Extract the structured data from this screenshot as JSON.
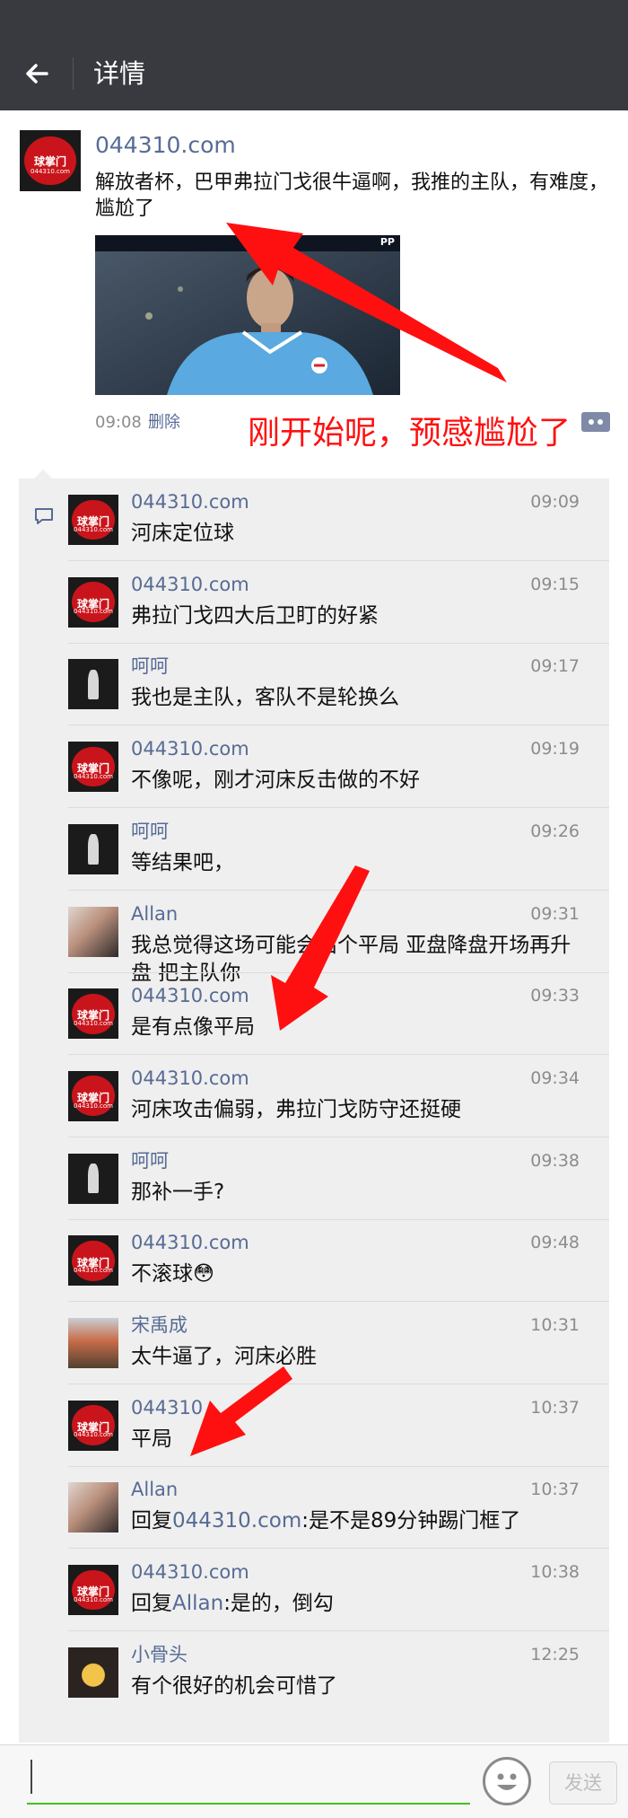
{
  "header": {
    "back_icon": "arrow-left-icon",
    "title": "详情"
  },
  "post": {
    "author": "044310.com",
    "text": "解放者杯，巴甲弗拉门戈很牛逼啊，我推的主队，有难度，尴尬了",
    "media": {
      "caption": "PP"
    },
    "time": "09:08",
    "delete_label": "删除",
    "overlay_annotation": "刚开始呢，预感尴尬了"
  },
  "comments": [
    {
      "name": "044310.com",
      "time": "09:09",
      "text": "河床定位球",
      "avatar": "logo"
    },
    {
      "name": "044310.com",
      "time": "09:15",
      "text": "弗拉门戈四大后卫盯的好紧",
      "avatar": "logo"
    },
    {
      "name": "呵呵",
      "time": "09:17",
      "text": "我也是主队，客队不是轮换么",
      "avatar": "dark"
    },
    {
      "name": "044310.com",
      "time": "09:19",
      "text": "不像呢，刚才河床反击做的不好",
      "avatar": "logo"
    },
    {
      "name": "呵呵",
      "time": "09:26",
      "text": "等结果吧，",
      "avatar": "dark"
    },
    {
      "name": "Allan",
      "time": "09:31",
      "text": "我总觉得这场可能会出个平局 亚盘降盘开场再升盘 把主队你",
      "avatar": "photo1"
    },
    {
      "name": "044310.com",
      "time": "09:33",
      "text": "是有点像平局",
      "avatar": "logo"
    },
    {
      "name": "044310.com",
      "time": "09:34",
      "text": "河床攻击偏弱，弗拉门戈防守还挺硬",
      "avatar": "logo"
    },
    {
      "name": "呵呵",
      "time": "09:38",
      "text": "那补一手?",
      "avatar": "dark"
    },
    {
      "name": "044310.com",
      "time": "09:48",
      "text": "不滚球😳",
      "avatar": "logo"
    },
    {
      "name": "宋禹成",
      "time": "10:31",
      "text": "太牛逼了，河床必胜",
      "avatar": "photo2"
    },
    {
      "name": "044310",
      "time": "10:37",
      "text": "平局",
      "avatar": "logo"
    },
    {
      "name": "Allan",
      "time": "10:37",
      "reply_prefix": "回复",
      "reply_to": "044310.com",
      "reply_text": ":是不是89分钟踢门框了",
      "avatar": "photo1"
    },
    {
      "name": "044310.com",
      "time": "10:38",
      "reply_prefix": "回复",
      "reply_to": "Allan",
      "reply_text": ":是的，倒勾",
      "avatar": "logo"
    },
    {
      "name": "小骨头",
      "time": "12:25",
      "text": "有个很好的机会可惜了",
      "avatar": "photo3"
    }
  ],
  "logo_avatar": {
    "title": "球掌门",
    "url": "044310.com"
  },
  "input": {
    "emoji_icon": "emoji-icon",
    "send_label": "发送"
  },
  "colors": {
    "header_bg": "#393a3f",
    "link": "#576b95",
    "annotation_red": "#ff1010",
    "input_underline": "#45c01a"
  }
}
